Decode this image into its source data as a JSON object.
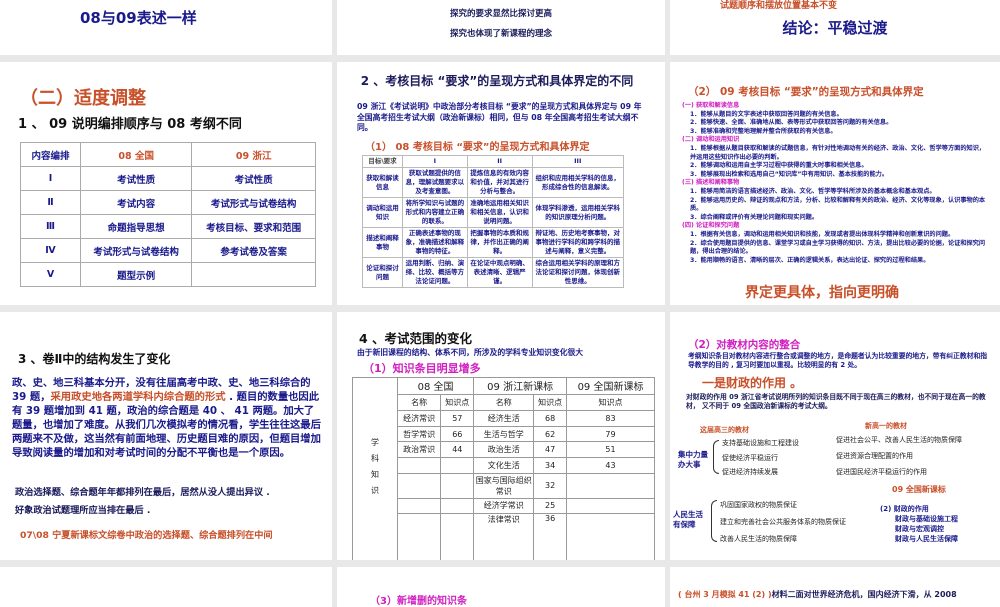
{
  "slides_row1": {
    "left": {
      "text": "08与09表述一样"
    },
    "middle": {
      "lines": [
        "探究的要求显然比探讨更高",
        "探究也体现了新课程的理念"
      ]
    },
    "right": {
      "note": "试题顺序和摆放位置基本不变",
      "conclusion": "结论：平稳过渡"
    }
  },
  "slide_adjust": {
    "title": "（二）适度调整",
    "subtitle": "1 、 09 说明编排顺序与 08 考纲不同",
    "headers": [
      "内容编排",
      "08 全国",
      "09 浙江"
    ],
    "rows": [
      [
        "Ⅰ",
        "考试性质",
        "考试性质"
      ],
      [
        "Ⅱ",
        "考试内容",
        "考试形式与试卷结构"
      ],
      [
        "Ⅲ",
        "命题指导思想",
        "考核目标、要求和范围"
      ],
      [
        "Ⅳ",
        "考试形式与试卷结构",
        "参考试卷及答案"
      ],
      [
        "Ⅴ",
        "题型示例",
        ""
      ]
    ]
  },
  "slide_goals": {
    "title": "2 、考核目标 “要求”的呈现方式和具体界定的不同",
    "paragraph": "09 浙江《考试说明》中政治部分考核目标 “要求”的呈现方式和具体界定与 09 年全国高考招生考试大纲（政治新课标）相同，但与 08 年全国高考招生考试大纲不同。",
    "subtitle": "（1） 08 考核目标 “要求”的呈现方式和具体界定",
    "headers": [
      "目标\\要求",
      "I",
      "II",
      "III"
    ],
    "rows": [
      [
        "获取和解读信息",
        "获取试题提供的信息，理解试题要求以及考查意图。",
        "提炼信息的有效内容和价值，并对其进行分析与整合。",
        "组织和应用相关学科的信息，形成综合性的信息解读。"
      ],
      [
        "调动和运用知识",
        "将所学知识与试题的形式和内容建立正确的联系。",
        "准确地运用相关知识和相关信息，认识和说明问题。",
        "体现学科渗透，运用相关学科的知识原理分析问题。"
      ],
      [
        "描述和阐释事物",
        "正确表述事物的现象，准确描述和解释事物的特征。",
        "把握事物的本质和规律，并作出正确的阐释。",
        "辩证地、历史地考察事物，对事物进行学科的和跨学科的描述与阐释，意义完整。"
      ],
      [
        "论证和探讨问题",
        "运用判断、归纳、演绎、比较、概括等方法论证问题。",
        "在论证中观点明确、表述清晰、逻辑严谨。",
        "综合运用相关学科的原理和方法论证和探讨问题，体现创新性思维。"
      ]
    ]
  },
  "slide_09goals": {
    "title": "（2） 09 考核目标 “要求”的呈现方式和具体界定",
    "sections": [
      {
        "head": "(一) 获取和解读信息",
        "items": [
          "1．能够从题目的文字表述中获取回答问题的有关信息。",
          "2．能够快速、全面、准确地从图、表等形式中获取回答问题的有关信息。",
          "3．能够准确和完整地理解并整合所获取的有关信息。"
        ]
      },
      {
        "head": "(二) 调动和运用知识",
        "items": [
          "1．能够根据从题目获取和解读的试题信息，有针对性地调动有关的经济、政治、文化、哲学等方面的知识，并运用这些知识作出必要的判断。",
          "2．能够调动和运用自主学习过程中获得的重大时事和相关信息。",
          "3．能够展现出检索和选用自己“知识库”中有用知识、基本技能的能力。"
        ]
      },
      {
        "head": "(三) 描述和阐释事物",
        "items": [
          "1．能够用简洁的语言描述经济、政治、文化、哲学等学科所涉及的基本概念和基本观点。",
          "2．能够运用历史的、辩证的观点和方法，分析、比较和解释有关的政治、经济、文化等现象，认识事物的本质。",
          "3．综合阐释或评价有关理论问题和现实问题。"
        ]
      },
      {
        "head": "(四) 论证和探究问题",
        "items": [
          "1．根据有关信息，调动和运用相关知识和技能，发现或者提出体现科学精神和创新意识的问题。",
          "2．综合使用题目提供的信息、课堂学习或自主学习获得的知识、方法，提出比较必要的论据，论证和探究问题，得出合理的结论。",
          "3．能用顺畅的语言、清晰的层次、正确的逻辑关系，表达出论证、探究的过程和结果。"
        ]
      }
    ],
    "conclusion": "界定更具体，指向更明确"
  },
  "slide_structure": {
    "title": "3 、卷Ⅱ中的结构发生了变化",
    "para_a": "政、史、地三科基本分开，没有往届高考中政、史、地三科综合的 39 题，",
    "para_highlight": "采用政史地各两道学科内综合题的形式",
    "para_b": " . 题目的数量也因此有 39 题增加到 41 题，政治的综合题是 40 、 41 两题。加大了题量，也增加了难度。从我们几次模拟考的情况看，学生往往这最后两题来不及做，这当然有前面地理、历史题目难的原因，但题目增加导致阅读量的增加和对考试时间的分配不平衡也是一个原因。",
    "line1": "政治选择题、综合题年年都排列在最后，居然从没人提出异议 .",
    "line2": "好象政治试题理所应当排在最后 .",
    "note": "07\\08 宁夏新课标文综卷中政治的选择题、综合题排列在中间"
  },
  "slide_scope": {
    "title": "4 、考试范围的变化",
    "subtitle": "由于新旧课程的结构、体系不同，所涉及的学科专业知识变化很大",
    "sub1": "（1）知识条目明显增多",
    "side_label": "学科知识",
    "groups": [
      "08 全国",
      "09 浙江新课标",
      "09 全国新课标"
    ],
    "cols": [
      "名称",
      "知识点",
      "名称",
      "知识点",
      "知识点"
    ],
    "rows": [
      [
        "经济常识",
        "57",
        "经济生活",
        "68",
        "83"
      ],
      [
        "哲学常识",
        "66",
        "生活与哲学",
        "62",
        "79"
      ],
      [
        "政治常识",
        "44",
        "政治生活",
        "47",
        "51"
      ],
      [
        "",
        "",
        "文化生活",
        "34",
        "43"
      ],
      [
        "",
        "",
        "国家与国际组织常识",
        "32",
        ""
      ],
      [
        "",
        "",
        "经济学常识",
        "25",
        ""
      ],
      [
        "",
        "",
        "法律常识",
        "36",
        ""
      ]
    ]
  },
  "slide_integration": {
    "title": "（2）对教材内容的整合",
    "para": "考纲知识条目对教材内容进行整合或调整的地方，是命题者认为比较重要的地方，带有纠正教材和指导教学的目的 , 复习时要加以重视。比较明显的有 2 处。",
    "point": "一是财政的作用 。",
    "para2": "对财政的作用 09 浙江省考试说明所列的知识条目既不同于现在高三的教材，也不同于现在高一的教材， 又不同于 09 全国政治新课标的考试大纲。",
    "old_label": "这届高三的教材",
    "group1": {
      "label": "集中力量办大事",
      "items": [
        "支持基础设施和工程建设",
        "促使经济平稳运行",
        "促进经济持续发展"
      ]
    },
    "group2": {
      "label": "人民生活有保障",
      "items": [
        "巩固国家政权的物质保证",
        "建立和完善社会公共服务体系的物质保证",
        "改善人民生活的物质保障"
      ]
    },
    "new_label": "新高一的教材",
    "new_items": [
      "促进社会公平、改善人民生活的物质保障",
      "促进资源合理配置的作用",
      "促进国民经济平稳运行的作用"
    ],
    "national_label": "09 全国新课标",
    "national_head": "(2) 财政的作用",
    "national_items": [
      "财政与基础设施工程",
      "财政与宏观调控",
      "财政与人民生活保障"
    ]
  },
  "slides_row4": {
    "middle": "（3）新增删的知识条",
    "right_src": "( 台州 3 月模拟  41 (2) )",
    "right_text": "材料二面对世界经济危机，国内经济下滑，从 2008"
  }
}
